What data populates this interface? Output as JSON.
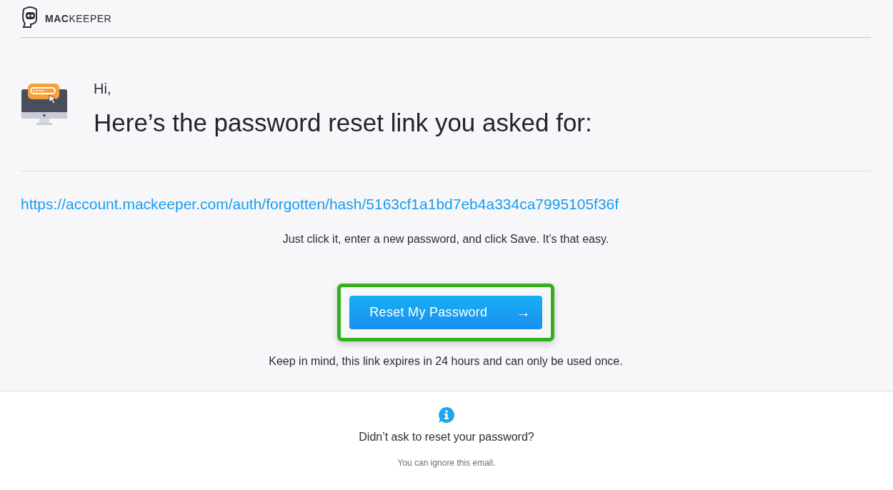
{
  "header": {
    "logo_text": "**MAC**KEEPER"
  },
  "greeting": "Hi,",
  "heading": "Here’s the password reset link you asked for:",
  "reset_link": "https://account.mackeeper.com/auth/forgotten/hash/5163cf1a1bd7eb4a334ca7995105f36f",
  "instructions": "Just click it, enter a new password, and click Save. It’s that easy.",
  "button": {
    "label": "Reset My Password",
    "icon": "→",
    "highlighted": true
  },
  "expiry_note": "Keep in mind, this link expires in 24 hours and can only be used once.",
  "footer": {
    "question": "Didn’t ask to reset your password?",
    "note": "You can ignore this email."
  }
}
